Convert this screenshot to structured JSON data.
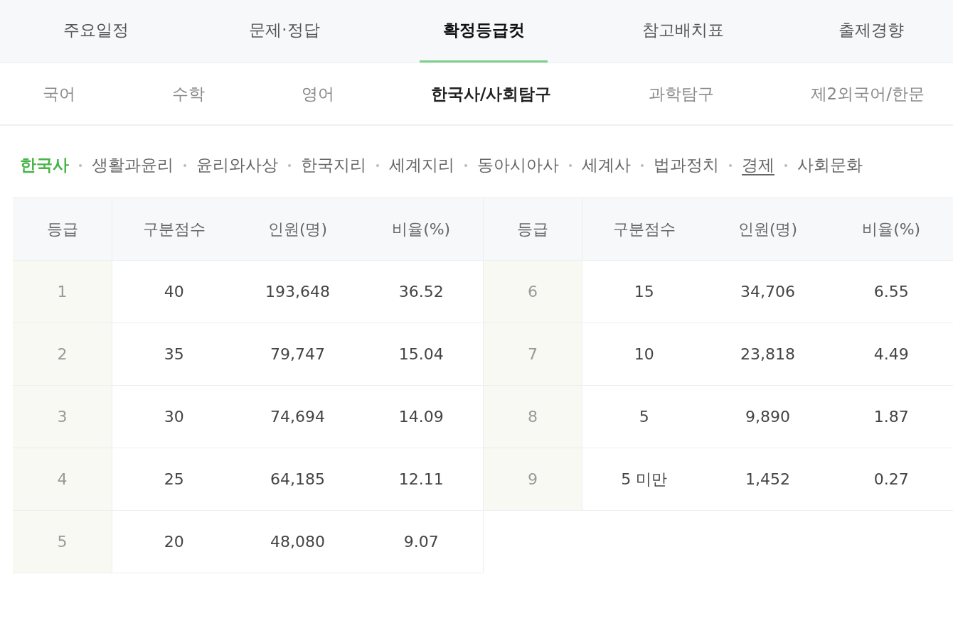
{
  "main_tabs": [
    {
      "label": "주요일정",
      "selected": false
    },
    {
      "label": "문제·정답",
      "selected": false
    },
    {
      "label": "확정등급컷",
      "selected": true
    },
    {
      "label": "참고배치표",
      "selected": false
    },
    {
      "label": "출제경향",
      "selected": false
    }
  ],
  "sub_tabs": [
    {
      "label": "국어",
      "selected": false
    },
    {
      "label": "수학",
      "selected": false
    },
    {
      "label": "영어",
      "selected": false
    },
    {
      "label": "한국사/사회탐구",
      "selected": true
    },
    {
      "label": "과학탐구",
      "selected": false
    },
    {
      "label": "제2외국어/한문",
      "selected": false
    }
  ],
  "subjects": [
    {
      "label": "한국사",
      "selected": true,
      "underlined": false
    },
    {
      "label": "생활과윤리",
      "selected": false,
      "underlined": false
    },
    {
      "label": "윤리와사상",
      "selected": false,
      "underlined": false
    },
    {
      "label": "한국지리",
      "selected": false,
      "underlined": false
    },
    {
      "label": "세계지리",
      "selected": false,
      "underlined": false
    },
    {
      "label": "동아시아사",
      "selected": false,
      "underlined": false
    },
    {
      "label": "세계사",
      "selected": false,
      "underlined": false
    },
    {
      "label": "법과정치",
      "selected": false,
      "underlined": false
    },
    {
      "label": "경제",
      "selected": false,
      "underlined": true
    },
    {
      "label": "사회문화",
      "selected": false,
      "underlined": false
    }
  ],
  "table": {
    "columns": [
      "등급",
      "구분점수",
      "인원(명)",
      "비율(%)",
      "등급",
      "구분점수",
      "인원(명)",
      "비율(%)"
    ],
    "rows": [
      [
        "1",
        "40",
        "193,648",
        "36.52",
        "6",
        "15",
        "34,706",
        "6.55"
      ],
      [
        "2",
        "35",
        "79,747",
        "15.04",
        "7",
        "10",
        "23,818",
        "4.49"
      ],
      [
        "3",
        "30",
        "74,694",
        "14.09",
        "8",
        "5",
        "9,890",
        "1.87"
      ],
      [
        "4",
        "25",
        "64,185",
        "12.11",
        "9",
        "5 미만",
        "1,452",
        "0.27"
      ],
      [
        "5",
        "20",
        "48,080",
        "9.07"
      ]
    ]
  }
}
